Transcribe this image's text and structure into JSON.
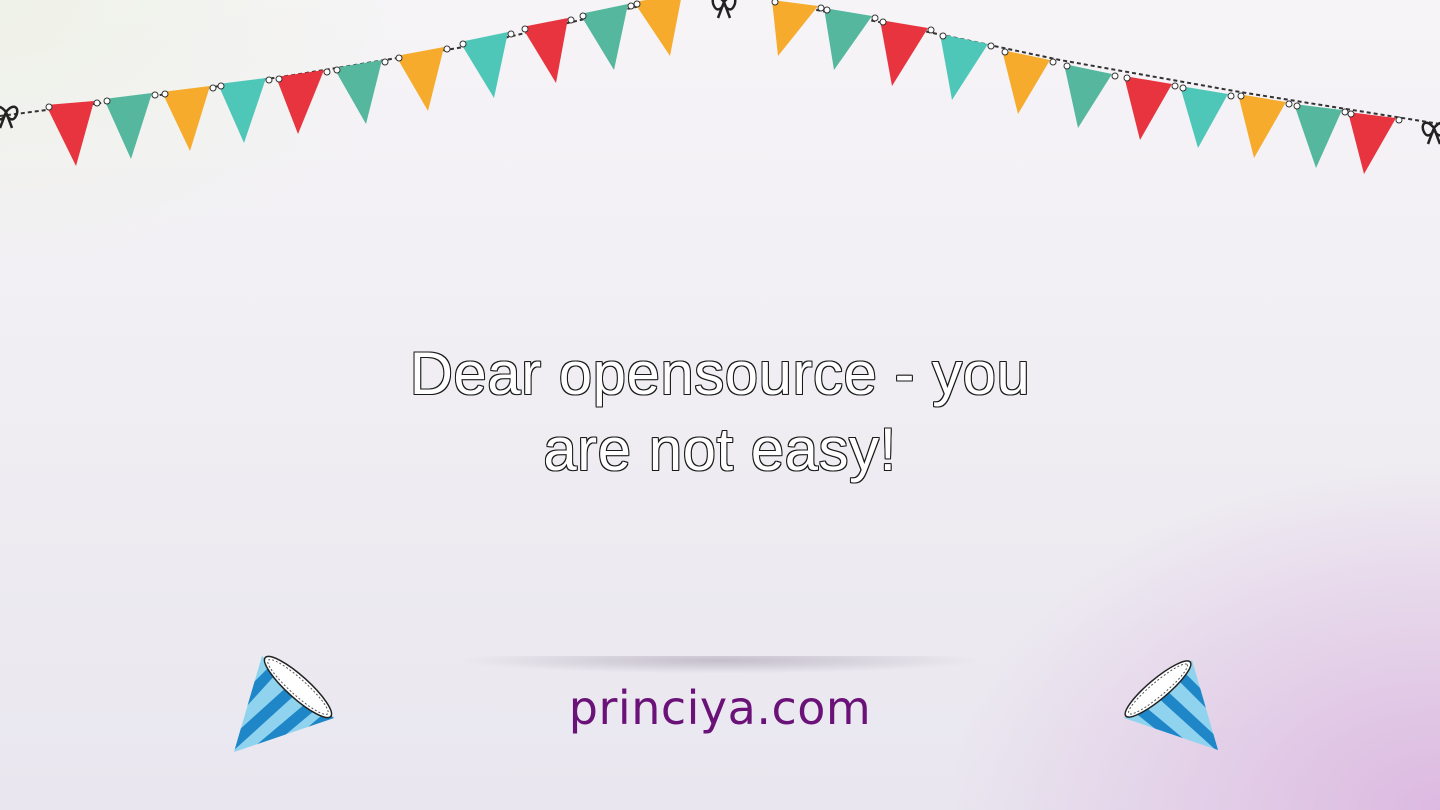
{
  "headline": {
    "line1": "Dear opensource - you",
    "line2": "are not easy!"
  },
  "footer": {
    "site": "princiya.com"
  },
  "colors": {
    "flag_palette": [
      "#e8343f",
      "#55b79e",
      "#f7ab2c",
      "#4fc7b8"
    ],
    "site_text": "#6a1278",
    "headline_fill": "#ffffff",
    "headline_outline": "#1a1a1a"
  },
  "icons": {
    "decor_top": "bunting-flags",
    "decor_bottom": "party-hat"
  }
}
